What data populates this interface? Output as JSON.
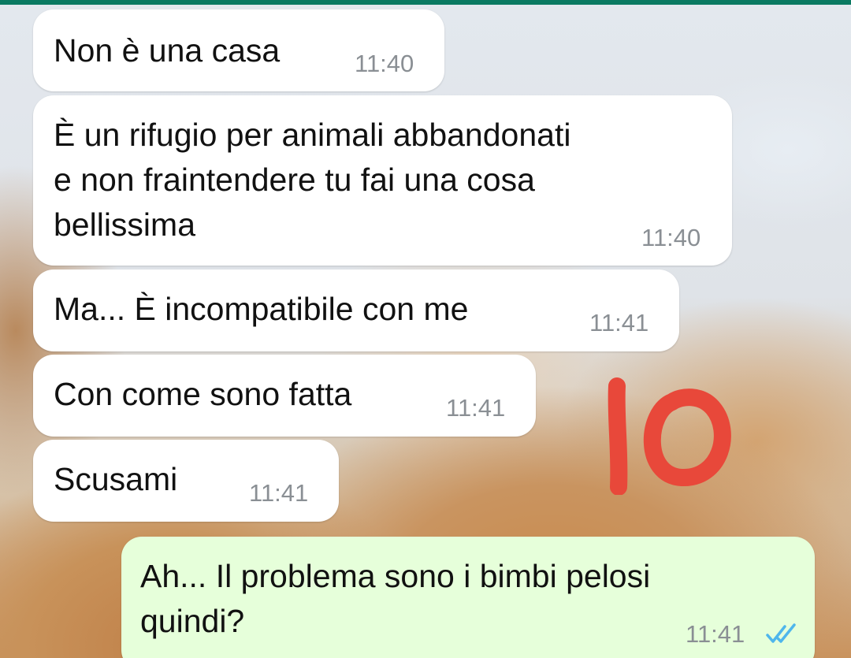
{
  "chat": {
    "messages": [
      {
        "direction": "incoming",
        "text": "Non è una casa",
        "time": "11:40"
      },
      {
        "direction": "incoming",
        "text": "È un rifugio per animali abbandonati\ne non fraintendere tu fai una cosa\nbellissima",
        "time": "11:40"
      },
      {
        "direction": "incoming",
        "text": "Ma... È incompatibile con me",
        "time": "11:41"
      },
      {
        "direction": "incoming",
        "text": "Con come sono fatta",
        "time": "11:41"
      },
      {
        "direction": "incoming",
        "text": "Scusami",
        "time": "11:41"
      },
      {
        "direction": "outgoing",
        "text": "Ah... Il problema sono i bimbi pelosi\nquindi?",
        "time": "11:41",
        "status": "read",
        "status_icon": "double-check-icon"
      }
    ]
  },
  "annotation": {
    "text": "IO",
    "color": "#e8483a"
  },
  "colors": {
    "incoming_bubble": "#ffffff",
    "outgoing_bubble": "#e6ffda",
    "read_tick": "#4fb6ec",
    "header_strip": "#0b7a62"
  }
}
